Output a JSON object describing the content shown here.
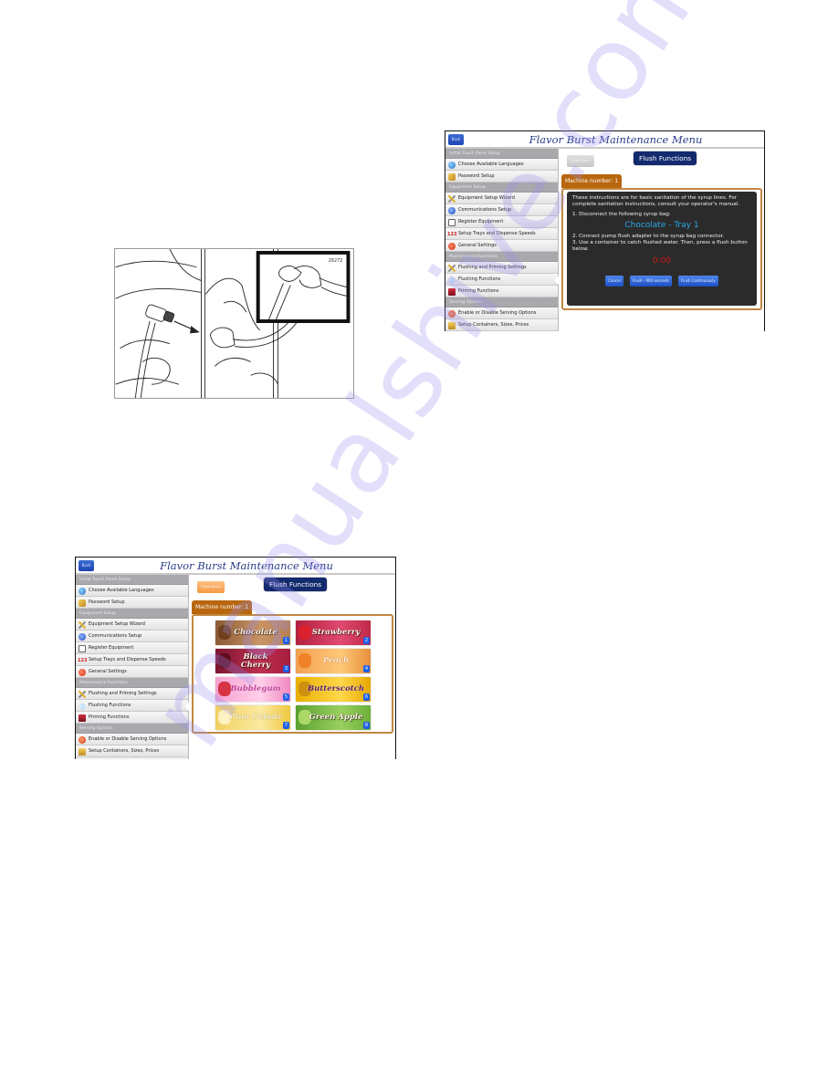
{
  "illustration": {
    "figure_number": "26272",
    "description": "Pump flush adapter being connected to syrup bag connector"
  },
  "app": {
    "title": "Flavor Burst Maintenance Menu",
    "back_label": "Back"
  },
  "sidebar": {
    "groups": [
      {
        "header": "Initial Touch Panel Setup",
        "items": [
          {
            "label": "Choose Available Languages",
            "icon": "globe-icon"
          },
          {
            "label": "Password Setup",
            "icon": "key-icon"
          }
        ]
      },
      {
        "header": "Equipment Setup",
        "items": [
          {
            "label": "Equipment Setup Wizard",
            "icon": "tools-icon"
          },
          {
            "label": "Communications Setup",
            "icon": "communications-icon"
          },
          {
            "label": "Register Equipment",
            "icon": "document-icon"
          },
          {
            "label": "Setup Trays and Dispense Speeds",
            "icon": "trays-icon",
            "glyph": "123"
          },
          {
            "label": "General Settings",
            "icon": "gear-icon"
          }
        ]
      },
      {
        "header": "Maintenance Functions",
        "items": [
          {
            "label": "Flushing and Priming Settings",
            "icon": "tools-icon"
          },
          {
            "label": "Flushing Functions",
            "icon": "water-drop-icon",
            "active": true
          },
          {
            "label": "Priming Functions",
            "icon": "pump-icon"
          }
        ]
      },
      {
        "header": "Serving Options",
        "items": [
          {
            "label": "Enable or Disable Serving Options",
            "icon": "serving-icon"
          },
          {
            "label": "Setup Containers, Sizes, Prices",
            "icon": "containers-icon"
          }
        ]
      }
    ]
  },
  "flush_screen_dialog": {
    "flush_spout_label": "Flush Spout",
    "section_title": "Flush Functions",
    "machine_tab": "Machine number: 1",
    "intro": "These instructions are for basic sanitation of the syrup lines. For complete sanitation instructions, consult your operator's manual.",
    "step1": "1. Disconnect the following syrup bag:",
    "syrup_bag": "Chocolate - Tray 1",
    "step2": "2. Connect pump flush adapter to the syrup bag connector.",
    "step3": "3. Use a container to catch flushed water. Then, press a flush button below.",
    "timer": "0:00",
    "buttons": {
      "cancel": "Cancel",
      "flush_timed": "Flush - 900 seconds",
      "flush_continuous": "Flush Continuously"
    }
  },
  "flush_screen_flavors": {
    "flush_spout_label": "Flush Spout",
    "section_title": "Flush Functions",
    "machine_tab": "Machine number: 1",
    "flavors": [
      {
        "name": "Chocolate",
        "tray": "1"
      },
      {
        "name": "Strawberry",
        "tray": "2"
      },
      {
        "name": "Black Cherry",
        "tray": "3"
      },
      {
        "name": "Peach",
        "tray": "4"
      },
      {
        "name": "Bubblegum",
        "tray": "5"
      },
      {
        "name": "Butterscotch",
        "tray": "6"
      },
      {
        "name": "Pina Colada",
        "tray": "7"
      },
      {
        "name": "Green Apple",
        "tray": "8"
      }
    ]
  },
  "colors": {
    "title_blue": "#2a3d8a",
    "section_navy": "#122a6e",
    "machine_tab_orange": "#b8660f",
    "panel_border": "#c08840",
    "syrup_text_blue": "#2aa8e8",
    "timer_red": "#d11a1a",
    "button_blue": "#1d4fc2",
    "tray_badge_blue": "#1f5fe8"
  },
  "watermark": "manualshive.com"
}
